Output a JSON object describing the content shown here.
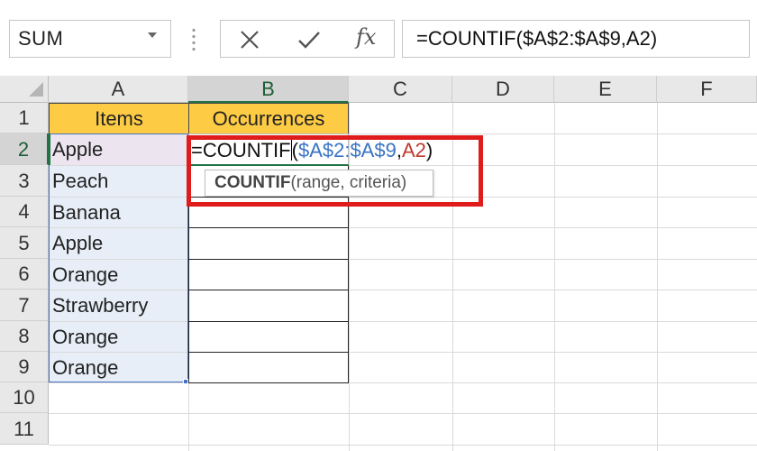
{
  "name_box": {
    "value": "SUM"
  },
  "formula_bar": {
    "cancel_icon": "x-icon",
    "enter_icon": "check-icon",
    "function_icon": "fx-icon",
    "fx_label": "fx",
    "value": "=COUNTIF($A$2:$A$9,A2)"
  },
  "columns": [
    "A",
    "B",
    "C",
    "D",
    "E",
    "F"
  ],
  "rows": [
    "1",
    "2",
    "3",
    "4",
    "5",
    "6",
    "7",
    "8",
    "9",
    "10",
    "11"
  ],
  "table": {
    "header_a": "Items",
    "header_b": "Occurrences",
    "items": [
      "Apple",
      "Peach",
      "Banana",
      "Apple",
      "Orange",
      "Strawberry",
      "Orange",
      "Orange"
    ]
  },
  "edit": {
    "fn": "=COUNTIF",
    "open_paren": "(",
    "range": "$A$2:$A$9",
    "comma": ",",
    "ref": "A2",
    "close_paren": ")"
  },
  "tooltip": {
    "fn": "COUNTIF",
    "args": "(range, criteria)"
  },
  "colors": {
    "header_fill": "#fecc44",
    "selection_fill": "#e7eef7",
    "accent": "#217346",
    "highlight": "#e01b1b",
    "range_ref": "#3a73c4",
    "cell_ref": "#c0392b"
  }
}
